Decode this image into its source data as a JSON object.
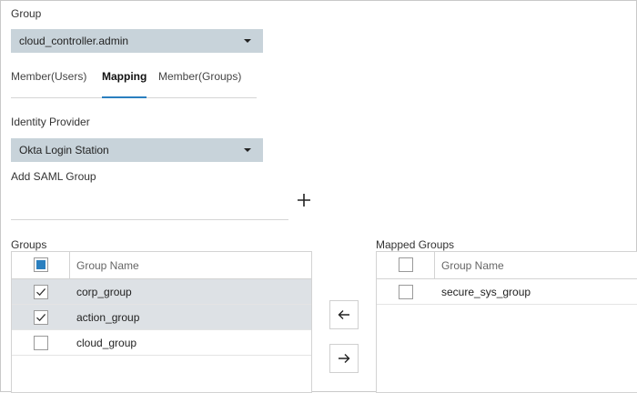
{
  "group": {
    "label": "Group",
    "selected": "cloud_controller.admin"
  },
  "tabs": [
    {
      "label": "Member(Users)",
      "active": false
    },
    {
      "label": "Mapping",
      "active": true
    },
    {
      "label": "Member(Groups)",
      "active": false
    }
  ],
  "identity_provider": {
    "label": "Identity Provider",
    "selected": "Okta Login Station"
  },
  "add_saml_group": {
    "label": "Add SAML Group",
    "value": "",
    "add_icon": "plus-icon"
  },
  "groups": {
    "label": "Groups",
    "column_header": "Group Name",
    "rows": [
      {
        "name": "corp_group",
        "checked": true
      },
      {
        "name": "action_group",
        "checked": true
      },
      {
        "name": "cloud_group",
        "checked": false
      }
    ]
  },
  "mapped_groups": {
    "label": "Mapped Groups",
    "column_header": "Group Name",
    "rows": [
      {
        "name": "secure_sys_group",
        "checked": false
      }
    ]
  },
  "buttons": {
    "move_left_icon": "arrow-left-icon",
    "move_right_icon": "arrow-right-icon"
  },
  "colors": {
    "accent": "#2a7fbf",
    "select_bg": "#c8d3da",
    "selected_row_bg": "#dde1e5"
  }
}
